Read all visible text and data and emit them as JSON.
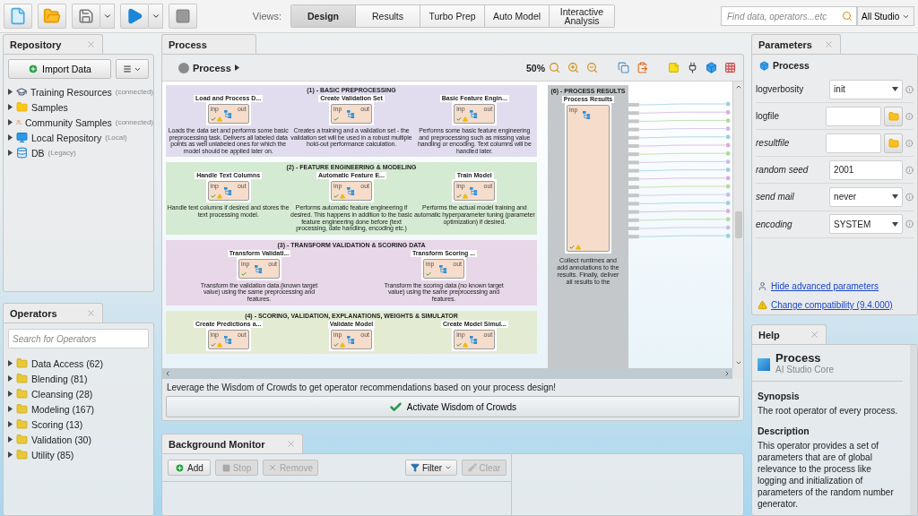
{
  "toolbar": {
    "views_label": "Views:",
    "views": [
      {
        "label": "Design",
        "selected": true
      },
      {
        "label": "Results",
        "selected": false
      },
      {
        "label": "Turbo Prep",
        "selected": false
      },
      {
        "label": "Auto Model",
        "selected": false
      },
      {
        "label": "Interactive Analysis",
        "selected": false
      }
    ],
    "search": {
      "placeholder": "Find data, operators...etc"
    },
    "scope": "All Studio"
  },
  "repository": {
    "title": "Repository",
    "import_button": "Import Data",
    "items": [
      {
        "name": "Training Resources",
        "note": "(connected)",
        "kind": "training"
      },
      {
        "name": "Samples",
        "kind": "folder"
      },
      {
        "name": "Community Samples",
        "note": "(connected)",
        "kind": "community"
      },
      {
        "name": "Local Repository",
        "note": "(Local)",
        "kind": "local"
      },
      {
        "name": "DB",
        "note": "(Legacy)",
        "kind": "db"
      }
    ]
  },
  "operators": {
    "title": "Operators",
    "search": {
      "placeholder": "Search for Operators"
    },
    "categories": [
      "Data Access (62)",
      "Blending (81)",
      "Cleansing (28)",
      "Modeling (167)",
      "Scoring (13)",
      "Validation (30)",
      "Utility (85)"
    ]
  },
  "process": {
    "title": "Process",
    "breadcrumb": "Process",
    "zoom": "50%",
    "sections": [
      {
        "title": "(1) - BASIC PREPROCESSING",
        "color": "#e1ddee",
        "nodes": [
          {
            "name": "Load and Process D...",
            "input": "inp",
            "output": "out",
            "ok": true,
            "warning": true,
            "description": "Loads the data set and performs some basic preprocessing task. Delivers all labeled data points as well unlabeled ones for which the model should be applied later on."
          },
          {
            "name": "Create Validation Set",
            "input": "inp",
            "output": "out",
            "ok": true,
            "warning": false,
            "description": "Creates a training and a validation set - the validation set will be used in a robust multiple hold-out performance calculation."
          },
          {
            "name": "Basic Feature Engin...",
            "input": "inp",
            "output": "out",
            "ok": true,
            "warning": true,
            "description": "Performs some basic feature engineering and preprocessing such as missing value handling or encoding. Text columns will be handled later."
          }
        ]
      },
      {
        "title": "(2) - FEATURE ENGINEERING & MODELING",
        "color": "#d5ead2",
        "nodes": [
          {
            "name": "Handle Text Columns",
            "input": "inp",
            "output": "out",
            "ok": true,
            "warning": true,
            "description": "Handle text columns if desired and stores the text processing model."
          },
          {
            "name": "Automatic Feature E...",
            "input": "inp",
            "output": "out",
            "ok": true,
            "warning": true,
            "description": "Performs automatic feature engineering if desired. This happens in addition to the basic feature engineering done before (text processing, date handling, encoding etc.)"
          },
          {
            "name": "Train Model",
            "input": "inp",
            "output": "out",
            "ok": true,
            "warning": true,
            "description": "Performs the actual model training and automatic hyperparameter tuning (parameter optimization) if desired."
          }
        ]
      },
      {
        "title": "(3) - TRANSFORM VALIDATION & SCORING DATA",
        "color": "#e7d7e8",
        "nodes": [
          {
            "name": "Transform Validati...",
            "input": "inp",
            "output": "out",
            "ok": true,
            "warning": false,
            "description": "Transform the validation data (known target value) using the same preprocessing and features."
          },
          {
            "name": "Transform Scoring ...",
            "input": "inp",
            "output": "out",
            "ok": true,
            "warning": false,
            "description": "Transform the scoring data (no known target value) using the same preprocessing and features."
          }
        ]
      },
      {
        "title": "(4) - SCORING, VALIDATION, EXPLANATIONS, WEIGHTS & SIMULATOR",
        "color": "#e3ebd3",
        "nodes": [
          {
            "name": "Create Predictions a...",
            "input": "inp",
            "output": "out",
            "ok": true,
            "warning": true
          },
          {
            "name": "Validate Model",
            "input": "inp",
            "output": "out",
            "ok": true,
            "warning": true
          },
          {
            "name": "Create Model Simul...",
            "input": "inp",
            "output": "out",
            "ok": true,
            "warning": true
          }
        ]
      }
    ],
    "results": {
      "title": "(6) - PROCESS RESULTS",
      "node": "Process Results",
      "input": "inp",
      "ok": true,
      "warning": true,
      "description": "Collect runtimes and add annotations to the results. Finally, deliver all results to the"
    }
  },
  "wisdom": {
    "text": "Leverage the Wisdom of Crowds to get operator recommendations based on your process design!",
    "button": "Activate Wisdom of Crowds"
  },
  "monitor": {
    "title": "Background Monitor",
    "buttons": [
      {
        "label": "Add",
        "kind": "add",
        "disabled": false
      },
      {
        "label": "Stop",
        "kind": "stop",
        "disabled": true
      },
      {
        "label": "Remove",
        "kind": "remove",
        "disabled": true
      },
      {
        "label": "Filter",
        "kind": "filter",
        "disabled": false
      },
      {
        "label": "Clear",
        "kind": "clear",
        "disabled": true
      }
    ]
  },
  "parameters": {
    "title": "Parameters",
    "operator": "Process",
    "rows": [
      {
        "label": "logverbosity",
        "kind": "select",
        "value": "init",
        "italic": false
      },
      {
        "label": "logfile",
        "kind": "file",
        "italic": false
      },
      {
        "label": "resultfile",
        "kind": "file",
        "italic": true
      },
      {
        "label": "random seed",
        "kind": "text",
        "value": "2001",
        "italic": true
      },
      {
        "label": "send mail",
        "kind": "select",
        "value": "never",
        "italic": true
      },
      {
        "label": "encoding",
        "kind": "select",
        "value": "SYSTEM",
        "italic": true
      }
    ],
    "links": [
      {
        "text": "Hide advanced parameters",
        "kind": "expert"
      },
      {
        "text": "Change compatibility (9.4.000)",
        "kind": "warning"
      }
    ]
  },
  "help": {
    "title": "Help",
    "operator": "Process",
    "subtitle": "AI Studio Core",
    "sections": [
      {
        "heading": "Synopsis",
        "text": "The root operator of every process."
      },
      {
        "heading": "Description",
        "text": "This operator provides a set of parameters that are of global relevance to the process like logging and initialization of parameters of the random number generator."
      }
    ]
  }
}
